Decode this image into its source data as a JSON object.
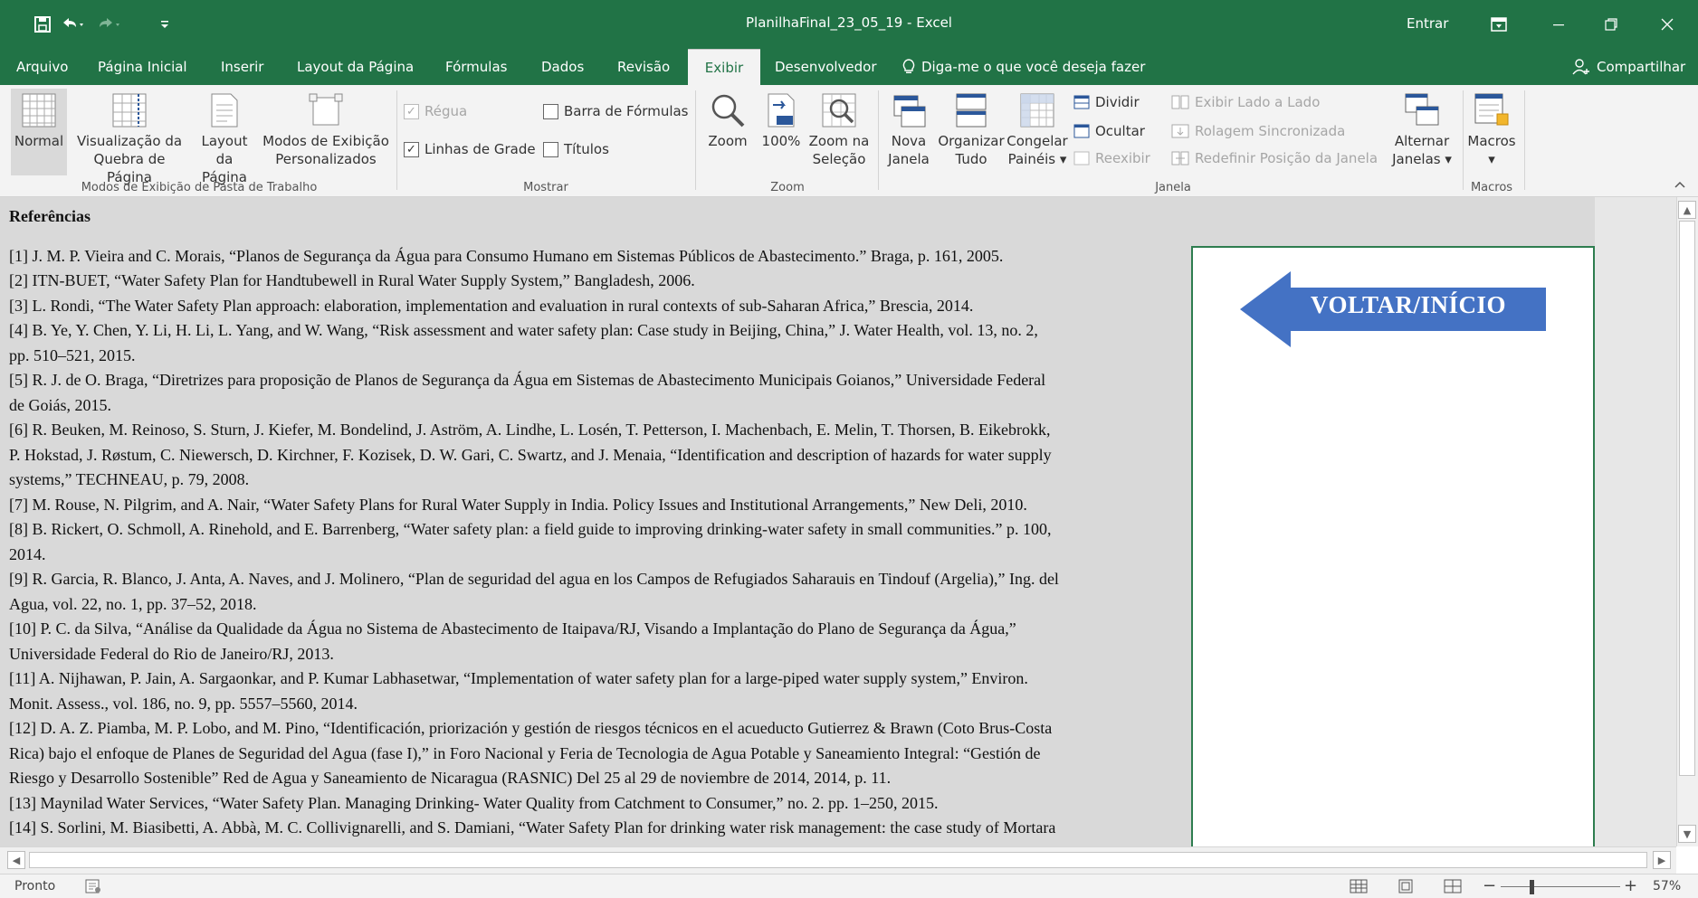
{
  "window": {
    "title": "PlanilhaFinal_23_05_19  -  Excel",
    "signin": "Entrar"
  },
  "tabs": [
    {
      "label": "Arquivo"
    },
    {
      "label": "Página Inicial"
    },
    {
      "label": "Inserir"
    },
    {
      "label": "Layout da Página"
    },
    {
      "label": "Fórmulas"
    },
    {
      "label": "Dados"
    },
    {
      "label": "Revisão"
    },
    {
      "label": "Exibir"
    },
    {
      "label": "Desenvolvedor"
    }
  ],
  "tell_me": "Diga-me o que você deseja fazer",
  "share": "Compartilhar",
  "ribbon": {
    "workbook_views": {
      "normal": "Normal",
      "page_break_l1": "Visualização da",
      "page_break_l2": "Quebra de Página",
      "page_layout_l1": "Layout",
      "page_layout_l2": "da Página",
      "custom_l1": "Modos de Exibição",
      "custom_l2": "Personalizados",
      "group": "Modos de Exibição de Pasta de Trabalho"
    },
    "show": {
      "ruler": "Régua",
      "formula_bar": "Barra de Fórmulas",
      "gridlines": "Linhas de Grade",
      "headings": "Títulos",
      "group": "Mostrar"
    },
    "zoom": {
      "zoom": "Zoom",
      "hundred": "100%",
      "selection_l1": "Zoom na",
      "selection_l2": "Seleção",
      "group": "Zoom"
    },
    "window_group": {
      "new_l1": "Nova",
      "new_l2": "Janela",
      "arrange_l1": "Organizar",
      "arrange_l2": "Tudo",
      "freeze_l1": "Congelar",
      "freeze_l2": "Painéis",
      "split": "Dividir",
      "hide": "Ocultar",
      "unhide": "Reexibir",
      "side_by_side": "Exibir Lado a Lado",
      "sync_scroll": "Rolagem Sincronizada",
      "reset_pos": "Redefinir Posição da Janela",
      "switch_l1": "Alternar",
      "switch_l2": "Janelas",
      "group": "Janela"
    },
    "macros": {
      "macros": "Macros",
      "group": "Macros"
    }
  },
  "sheet": {
    "title": "Referências",
    "lines": [
      "[1] J. M. P. Vieira and C. Morais, “Planos de Segurança da Água para Consumo Humano em Sistemas Públicos de Abastecimento.” Braga, p. 161, 2005.",
      "[2] ITN-BUET, “Water Safety Plan for Handtubewell in Rural Water Supply System,” Bangladesh, 2006.",
      "[3] L. Rondi, “The Water Safety Plan approach: elaboration, implementation and evaluation in rural contexts of sub-Saharan Africa,” Brescia, 2014.",
      "[4] B. Ye, Y. Chen, Y. Li, H. Li, L. Yang, and W. Wang, “Risk assessment and water safety plan: Case study in Beijing, China,” J. Water Health, vol. 13, no. 2,",
      "pp. 510–521, 2015.",
      "[5] R. J. de O. Braga, “Diretrizes para proposição de Planos de Segurança da Água em Sistemas de Abastecimento Municipais Goianos,” Universidade Federal",
      "de Goiás, 2015.",
      "[6] R. Beuken, M. Reinoso, S. Sturn, J. Kiefer, M. Bondelind, J. Aström, A. Lindhe, L. Losén, T. Petterson, I. Machenbach, E. Melin, T. Thorsen, B. Eikebrokk,",
      "P. Hokstad, J. Røstum, C. Niewersch, D. Kirchner, F. Kozisek, D. W. Gari, C. Swartz, and J. Menaia, “Identification and description of hazards for water supply",
      "systems,” TECHNEAU, p. 79, 2008.",
      "[7] M. Rouse, N. Pilgrim, and A. Nair, “Water Safety Plans for Rural Water Supply in India. Policy Issues and Institutional Arrangements,” New Deli, 2010.",
      "[8] B. Rickert, O. Schmoll, A. Rinehold, and E. Barrenberg, “Water safety plan: a field guide to improving drinking-water safety in small communities.” p. 100,",
      "2014.",
      "[9] R. Garcia, R. Blanco, J. Anta, A. Naves, and J. Molinero, “Plan de seguridad del agua en los Campos de Refugiados Saharauis en Tindouf (Argelia),” Ing. del",
      "Agua, vol. 22, no. 1, pp. 37–52, 2018.",
      "[10] P. C. da Silva, “Análise da Qualidade da Água no Sistema de Abastecimento de Itaipava/RJ, Visando a Implantação do Plano de Segurança da Água,”",
      "Universidade Federal do Rio de Janeiro/RJ, 2013.",
      "[11] A. Nijhawan, P. Jain, A. Sargaonkar, and P. Kumar Labhasetwar, “Implementation of water safety plan for a large-piped water supply system,” Environ.",
      "Monit. Assess., vol. 186, no. 9, pp. 5557–5560, 2014.",
      "[12] D. A. Z. Piamba, M. P. Lobo, and M. Pino, “Identificación, priorización y gestión de riesgos técnicos en el acueducto Gutierrez & Brawn (Coto Brus-Costa",
      "Rica) bajo el enfoque de Planes de Seguridad del Agua (fase I),” in Foro Nacional y Feria de Tecnologia de Agua Potable y Saneamiento Integral: “Gestión de",
      "Riesgo y Desarrollo Sostenible” Red de Agua y Saneamiento de Nicaragua (RASNIC) Del 25 al 29 de noviembre de 2014, 2014, p. 11.",
      "[13] Maynilad Water Services, “Water Safety Plan. Managing Drinking- Water Quality from Catchment to Consumer,” no. 2. pp. 1–250, 2015.",
      "[14] S. Sorlini, M. Biasibetti, A. Abbà, M. C. Collivignarelli, and S. Damiani, “Water Safety Plan for drinking water risk management: the case study of Mortara"
    ],
    "back_button": "VOLTAR/INÍCIO"
  },
  "status": {
    "ready": "Pronto",
    "zoom": "57%"
  },
  "colors": {
    "excel_green": "#217346",
    "arrow_blue": "#4472c4",
    "panel_border": "#2e7d4f"
  }
}
